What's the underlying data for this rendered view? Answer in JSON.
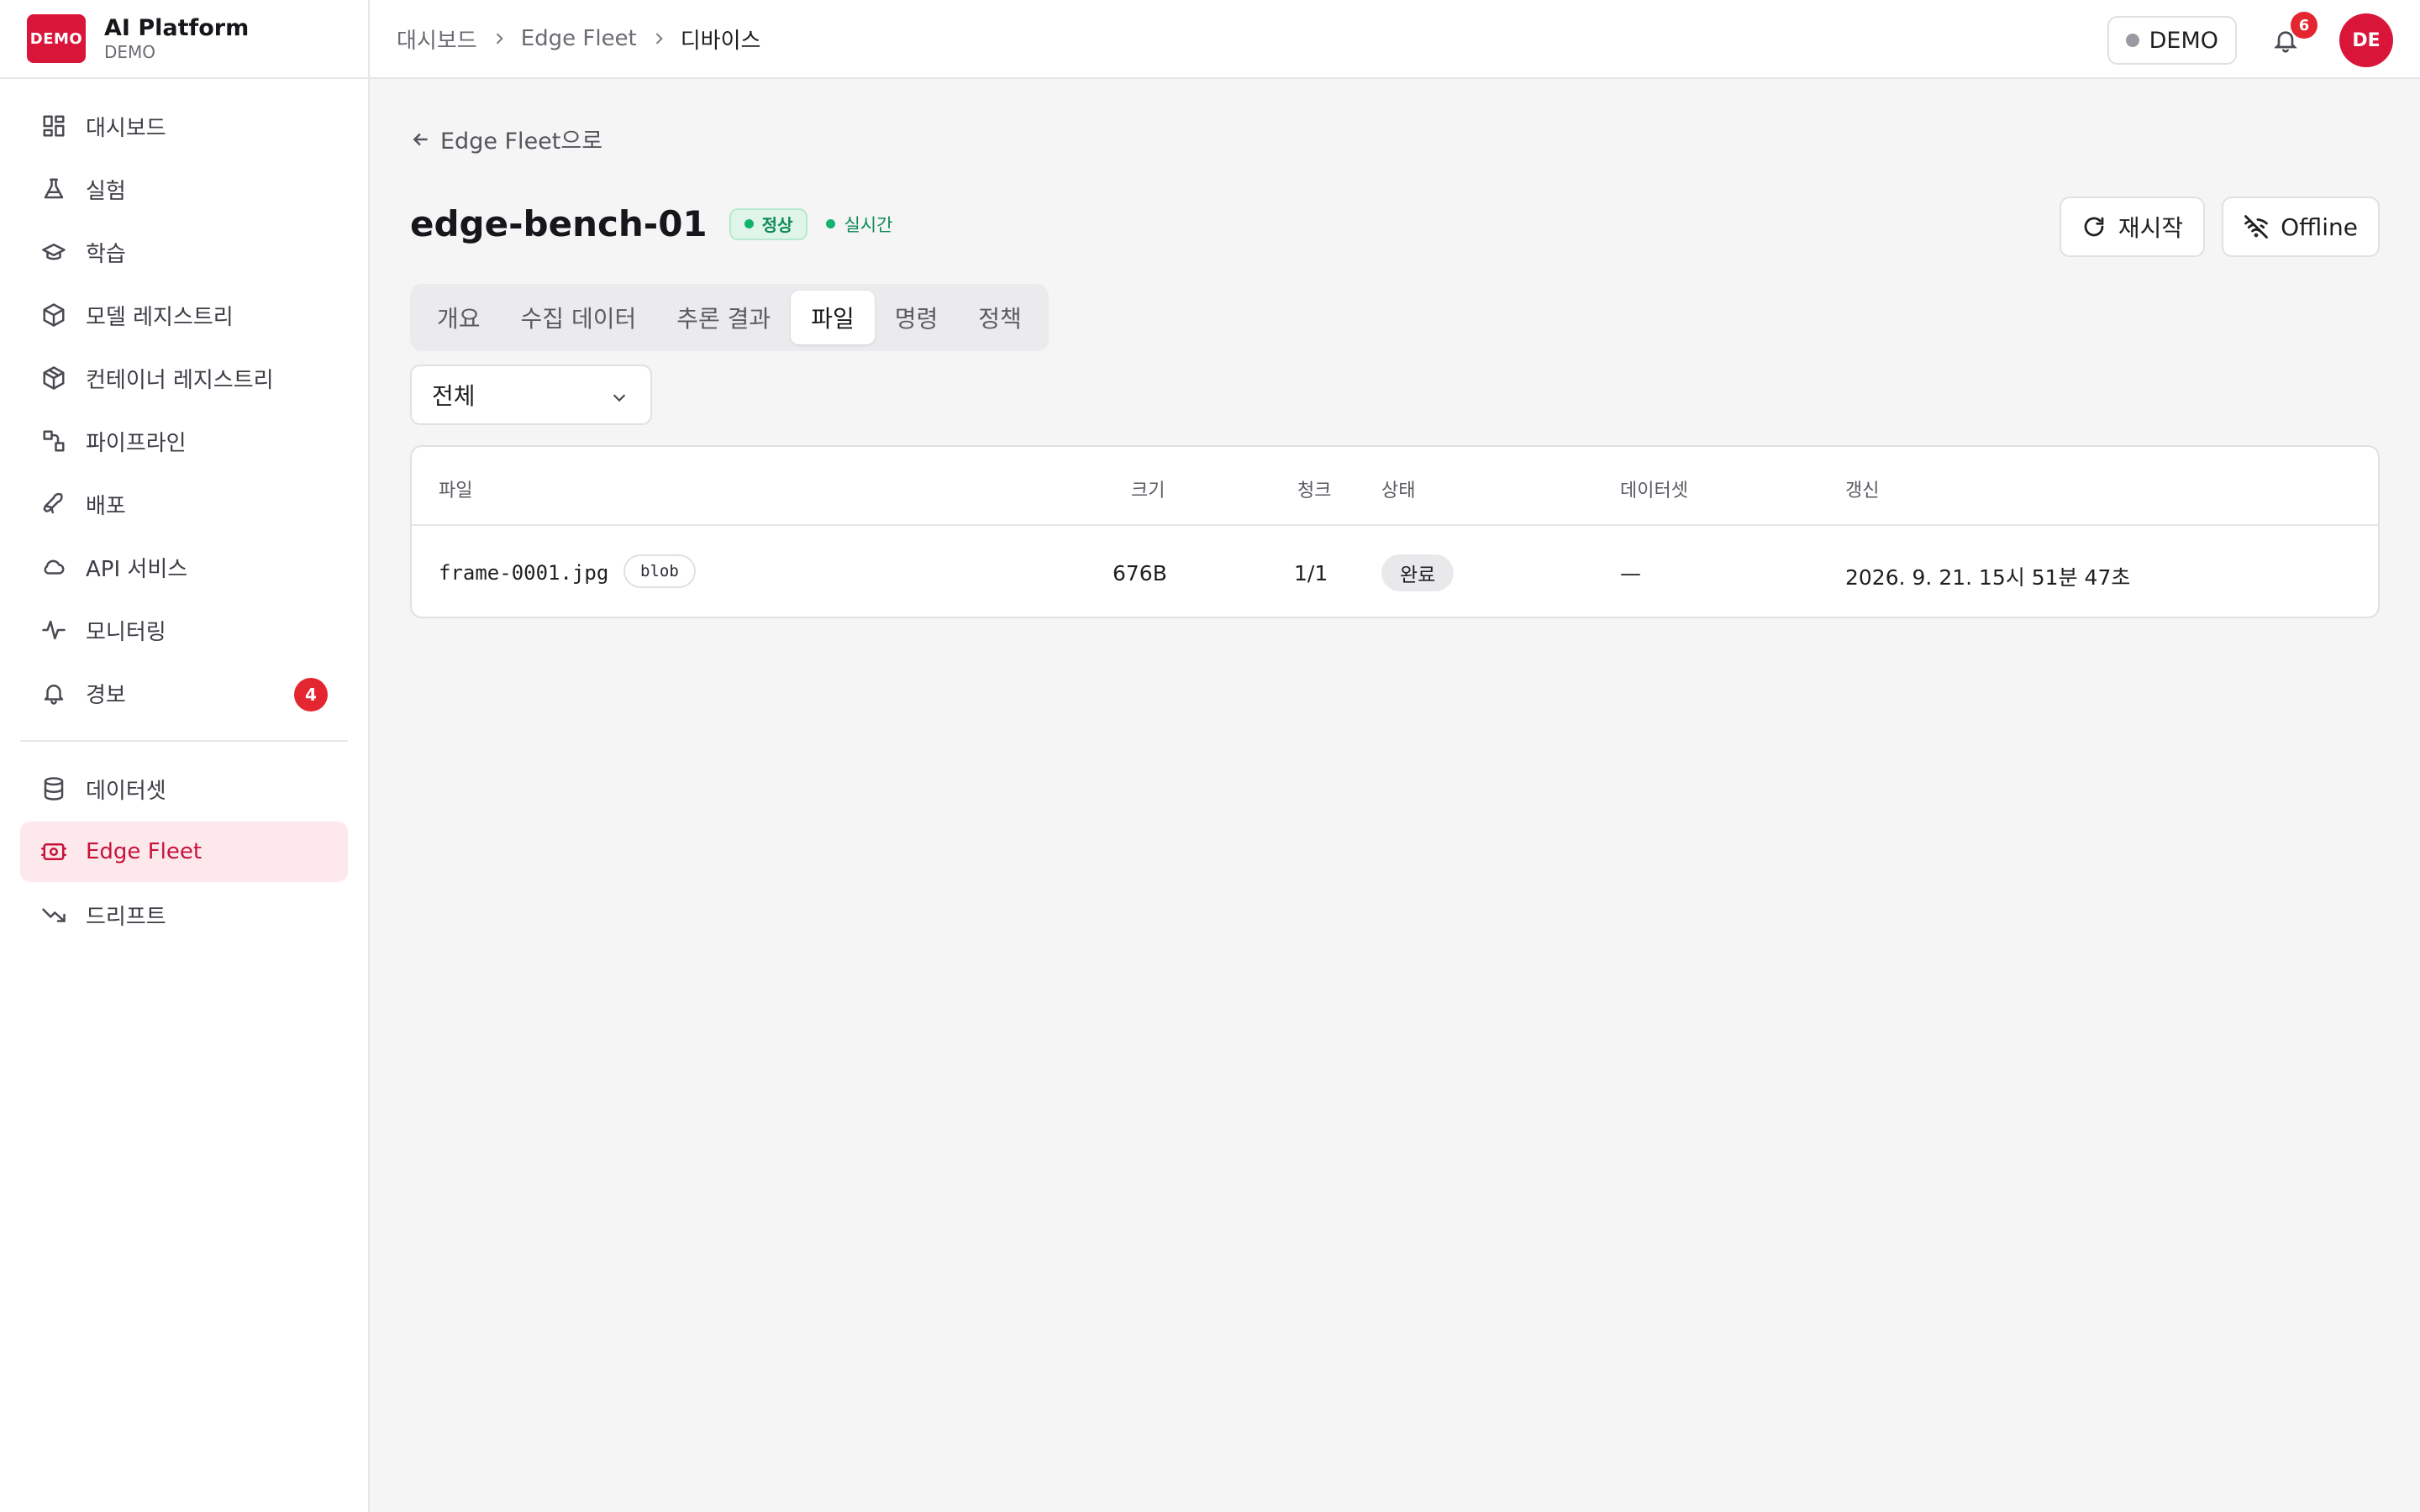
{
  "brand": {
    "logo_text": "DEMO",
    "title": "AI Platform",
    "subtitle": "DEMO"
  },
  "sidebar": {
    "items": [
      {
        "label": "대시보드",
        "icon": "dashboard-icon"
      },
      {
        "label": "실험",
        "icon": "flask-icon"
      },
      {
        "label": "학습",
        "icon": "graduation-cap-icon"
      },
      {
        "label": "모델 레지스트리",
        "icon": "cube-icon"
      },
      {
        "label": "컨테이너 레지스트리",
        "icon": "container-icon"
      },
      {
        "label": "파이프라인",
        "icon": "pipeline-icon"
      },
      {
        "label": "배포",
        "icon": "rocket-icon"
      },
      {
        "label": "API 서비스",
        "icon": "cloud-icon"
      },
      {
        "label": "모니터링",
        "icon": "activity-icon"
      },
      {
        "label": "경보",
        "icon": "bell-icon",
        "badge": "4"
      }
    ],
    "items2": [
      {
        "label": "데이터셋",
        "icon": "database-icon"
      },
      {
        "label": "Edge Fleet",
        "icon": "edge-fleet-icon",
        "active": true
      },
      {
        "label": "드리프트",
        "icon": "trend-down-icon"
      }
    ]
  },
  "topbar": {
    "breadcrumb": [
      "대시보드",
      "Edge Fleet",
      "디바이스"
    ],
    "env_label": "DEMO",
    "notification_count": "6",
    "avatar_initials": "DE"
  },
  "page": {
    "back_label": "Edge Fleet으로",
    "device_name": "edge-bench-01",
    "status_label": "정상",
    "live_label": "실시간",
    "restart_label": "재시작",
    "offline_label": "Offline",
    "tabs": [
      "개요",
      "수집 데이터",
      "추론 결과",
      "파일",
      "명령",
      "정책"
    ],
    "active_tab": "파일",
    "filter_value": "전체"
  },
  "table": {
    "headers": {
      "file": "파일",
      "size": "크기",
      "chunks": "청크",
      "status": "상태",
      "dataset": "데이터셋",
      "updated": "갱신"
    },
    "rows": [
      {
        "file": "frame-0001.jpg",
        "kind": "blob",
        "size": "676B",
        "chunks": "1/1",
        "status": "완료",
        "dataset": "—",
        "updated": "2026. 9. 21. 15시 51분 47초"
      }
    ]
  },
  "colors": {
    "brand": "#d9163a",
    "active_bg": "#fde8ec",
    "success": "#0f8a54",
    "badge": "#e3262f"
  }
}
